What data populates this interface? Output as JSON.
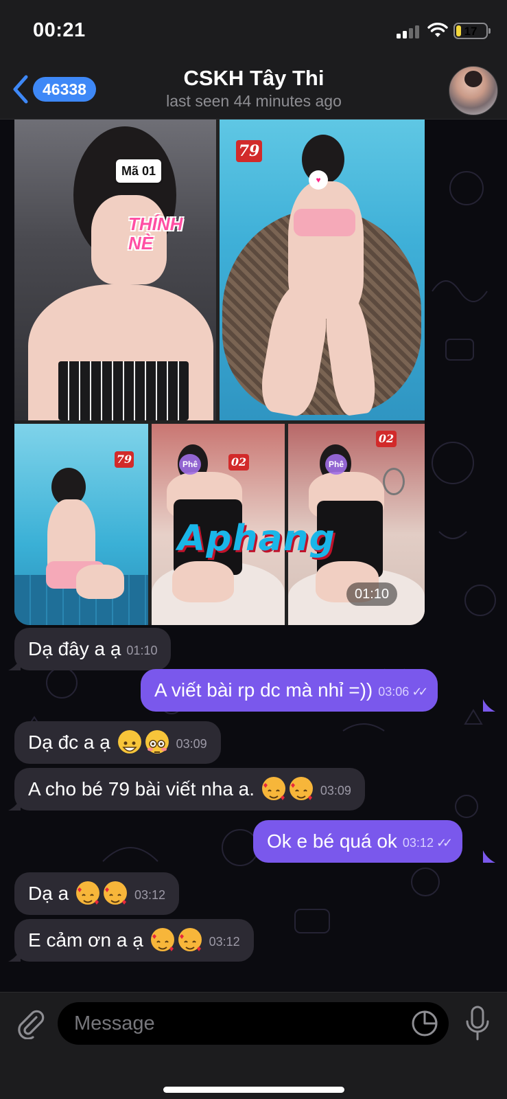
{
  "status_bar": {
    "time": "00:21",
    "battery": "17",
    "battery_level": 0.17
  },
  "header": {
    "back_count": "46338",
    "title": "CSKH Tây Thi",
    "subtitle": "last seen 44 minutes ago"
  },
  "album": {
    "photo_1_tag": "Mã 01",
    "photo_1_sticker": "THÍNH NÈ",
    "photo_2_tag": "79",
    "photo_3_tag": "79",
    "photo_4_tag": "02",
    "photo_4_face": "Phê",
    "photo_5_tag": "02",
    "photo_5_face": "Phê",
    "watermark": "Aphang",
    "time": "01:10"
  },
  "messages": [
    {
      "direction": "in",
      "text": "Dạ đây a ạ",
      "emojis": [],
      "time": "01:10"
    },
    {
      "direction": "out",
      "text": "A viết bài rp dc mà nhỉ =))",
      "emojis": [],
      "time": "03:06",
      "read": true
    },
    {
      "direction": "in",
      "text": "Dạ đc a ạ",
      "emojis": [
        "grinning-emoji",
        "flushed-emoji"
      ],
      "time": "03:09"
    },
    {
      "direction": "in",
      "text": "A cho bé 79 bài viết nha a.",
      "emojis": [
        "smiling-hearts-emoji",
        "smiling-hearts-emoji"
      ],
      "time": "03:09"
    },
    {
      "direction": "out",
      "text": "Ok e bé quá ok",
      "emojis": [],
      "time": "03:12",
      "read": true
    },
    {
      "direction": "in",
      "text": "Dạ a",
      "emojis": [
        "smiling-hearts-emoji",
        "smiling-hearts-emoji"
      ],
      "time": "03:12"
    },
    {
      "direction": "in",
      "text": "E cảm ơn a ạ",
      "emojis": [
        "smiling-hearts-emoji",
        "smiling-hearts-emoji"
      ],
      "time": "03:12"
    }
  ],
  "composer": {
    "placeholder": "Message"
  },
  "colors": {
    "outgoing_bubble": "#7a58ec",
    "incoming_bubble": "#2c2a33",
    "accent": "#3e88f7",
    "background": "#0b0b10"
  },
  "icons": {
    "back": "chevron-left-icon",
    "attach": "paperclip-icon",
    "sticker": "sticker-icon",
    "mic": "microphone-icon",
    "read": "double-check-icon"
  }
}
